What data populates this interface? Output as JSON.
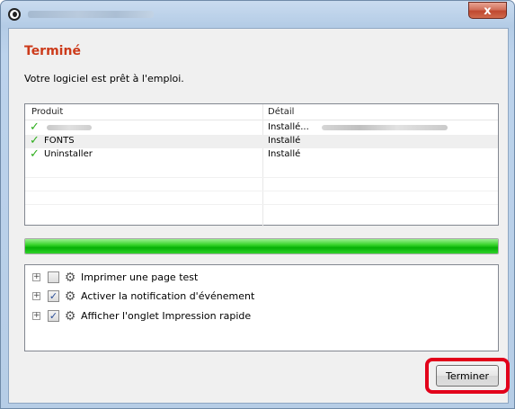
{
  "window": {
    "title_text": "",
    "close_glyph": "x"
  },
  "page": {
    "heading": "Terminé",
    "subtitle": "Votre logiciel est prêt à l'emploi."
  },
  "product_list": {
    "columns": [
      "Produit",
      "Détail"
    ],
    "rows": [
      {
        "product": "",
        "detail": "Installé...",
        "checked": true
      },
      {
        "product": "FONTS",
        "detail": "Installé",
        "checked": true
      },
      {
        "product": "Uninstaller",
        "detail": "Installé",
        "checked": true
      }
    ]
  },
  "progress": {
    "percent": 100,
    "color": "#06b006"
  },
  "options": [
    {
      "label": "Imprimer une page test",
      "checked": false
    },
    {
      "label": "Activer la notification d'événement",
      "checked": true
    },
    {
      "label": "Afficher l'onglet Impression rapide",
      "checked": true
    }
  ],
  "footer": {
    "finish_label": "Terminer",
    "highlight_color": "#e2001a"
  },
  "colors": {
    "heading": "#cc3a1a",
    "check": "#2fae1e"
  }
}
